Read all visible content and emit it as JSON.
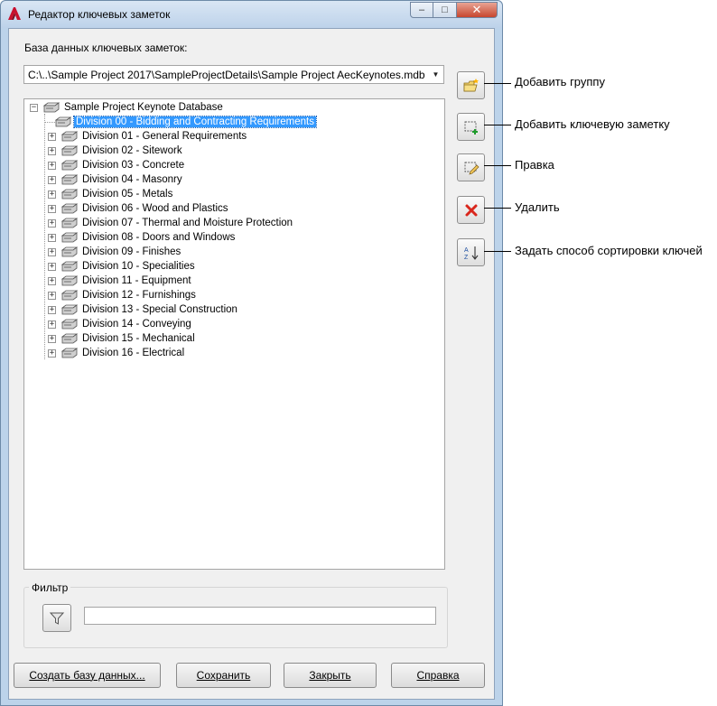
{
  "window": {
    "title": "Редактор ключевых заметок",
    "buttons": {
      "minimize": "–",
      "maximize": "□",
      "close": "✕"
    }
  },
  "database": {
    "label": "База данных ключевых заметок:",
    "selected_path": "C:\\..\\Sample Project 2017\\SampleProjectDetails\\Sample Project AecKeynotes.mdb"
  },
  "tree": {
    "root": {
      "label": "Sample Project Keynote Database",
      "expander": "−"
    },
    "items": [
      {
        "label": "Division 00 - Bidding and Contracting Requirements",
        "selected": true,
        "expander": ""
      },
      {
        "label": "Division 01 - General Requirements",
        "expander": "+"
      },
      {
        "label": "Division 02 - Sitework",
        "expander": "+"
      },
      {
        "label": "Division 03 - Concrete",
        "expander": "+"
      },
      {
        "label": "Division 04 - Masonry",
        "expander": "+"
      },
      {
        "label": "Division 05 - Metals",
        "expander": "+"
      },
      {
        "label": "Division 06 - Wood and Plastics",
        "expander": "+"
      },
      {
        "label": "Division 07 - Thermal and Moisture Protection",
        "expander": "+"
      },
      {
        "label": "Division 08 - Doors and Windows",
        "expander": "+"
      },
      {
        "label": "Division 09 - Finishes",
        "expander": "+"
      },
      {
        "label": "Division 10 - Specialities",
        "expander": "+"
      },
      {
        "label": "Division 11 - Equipment",
        "expander": "+"
      },
      {
        "label": "Division 12 - Furnishings",
        "expander": "+"
      },
      {
        "label": "Division 13 - Special Construction",
        "expander": "+"
      },
      {
        "label": "Division 14 - Conveying",
        "expander": "+"
      },
      {
        "label": "Division 15 - Mechanical",
        "expander": "+"
      },
      {
        "label": "Division 16 - Electrical",
        "expander": "+"
      }
    ]
  },
  "side_buttons": {
    "add_group": {
      "icon": "folder-add-icon"
    },
    "add_keynote": {
      "icon": "keynote-add-icon"
    },
    "edit": {
      "icon": "edit-icon"
    },
    "delete": {
      "icon": "delete-icon"
    },
    "sort": {
      "icon": "sort-az-icon"
    }
  },
  "callouts": {
    "add_group": "Добавить группу",
    "add_keynote": "Добавить ключевую заметку",
    "edit": "Правка",
    "delete": "Удалить",
    "sort": "Задать способ сортировки ключей"
  },
  "filter": {
    "legend": "Фильтр",
    "value": "",
    "icon": "filter-icon"
  },
  "bottom_buttons": {
    "create_db": "Создать базу данных...",
    "save": "Сохранить",
    "close": "Закрыть",
    "help": "Справка"
  },
  "colors": {
    "selection": "#3399ff",
    "delete_icon": "#d9261c"
  }
}
